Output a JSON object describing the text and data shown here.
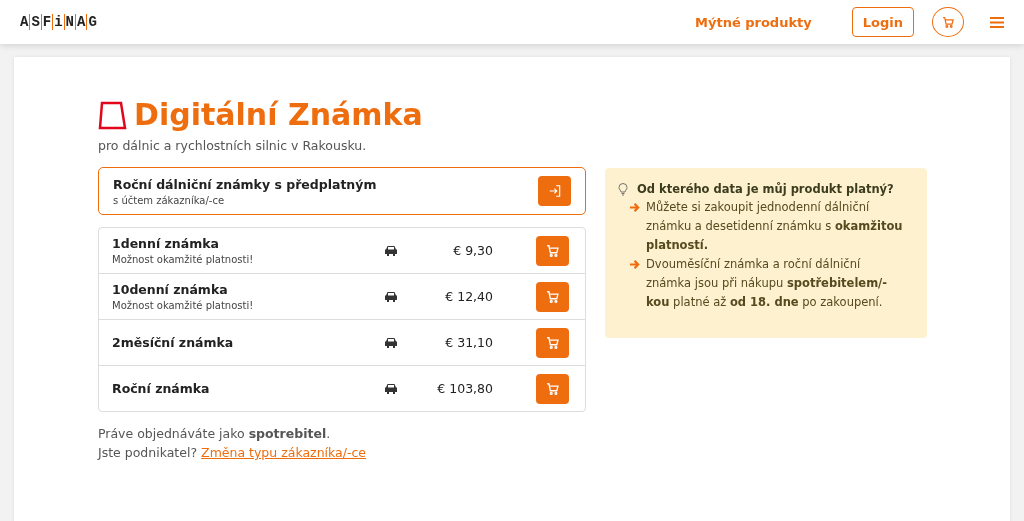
{
  "header": {
    "logo": "ASFiNAG",
    "nav_link": "Mýtné produkty",
    "login": "Login"
  },
  "title": "Digitální Známka",
  "subtitle": "pro dálnic a rychlostních silnic v Rakousku.",
  "subscription": {
    "title": "Roční dálniční známky s předplatným",
    "subtitle": "s účtem zákazníka/-ce"
  },
  "products": [
    {
      "name": "1denní známka",
      "note": "Možnost okamžité platnosti!",
      "price": "€ 9,30"
    },
    {
      "name": "10denní známka",
      "note": "Možnost okamžité platnosti!",
      "price": "€ 12,40"
    },
    {
      "name": "2měsíční známka",
      "price": "€ 31,10"
    },
    {
      "name": "Roční známka",
      "price": "€ 103,80"
    }
  ],
  "customer_note": "Práve objednáváte jako **spotrebitel**.",
  "business_question": "Jste podnikatel?",
  "change_link": "Změna typu zákazníka/-ce",
  "info": {
    "title": "Od kterého data je můj produkt platný?",
    "items": [
      "Můžete si zakoupit jednodenní dálniční známku a desetidenní známku s **okamžitou platností.**",
      "Dvouměsíční známka a roční dálniční známka jsou při nákupu **spotřebitelem/-kou** platné až **od 18. dne** po zakoupení."
    ]
  }
}
